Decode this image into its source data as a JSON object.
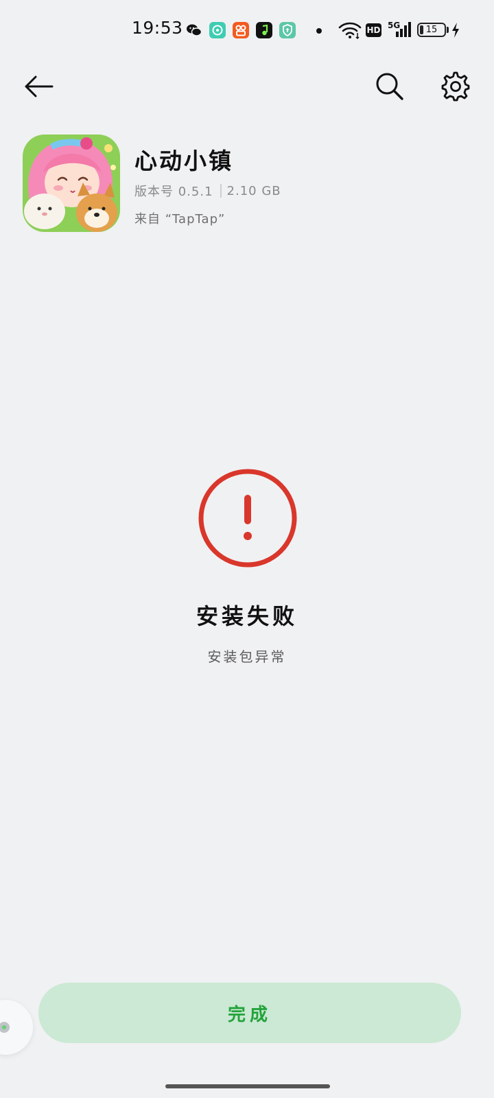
{
  "status_bar": {
    "time": "19:53",
    "battery_level": "15",
    "network": "5G",
    "hd_label": "HD",
    "notification_icons": [
      "wechat-icon",
      "bubble-app-icon",
      "kuaishou-icon",
      "music-app-icon",
      "shield-app-icon"
    ],
    "colors": {
      "bubble": "#3fcdb1",
      "kuaishou": "#f35a1f",
      "music": "#111111",
      "shield": "#5cc7a8"
    }
  },
  "header": {
    "back_icon": "arrow-left-icon",
    "search_icon": "search-icon",
    "settings_icon": "gear-icon"
  },
  "app": {
    "name": "心动小镇",
    "version": "版本号 0.5.1",
    "size": "2.10 GB",
    "source": "来自 “TapTap”"
  },
  "result": {
    "icon": "error-exclamation-icon",
    "title": "安装失败",
    "description": "安装包异常",
    "error_color": "#d9372b"
  },
  "actions": {
    "done_label": "完成",
    "done_bg": "#cbe9d4",
    "done_color": "#24a33b"
  }
}
